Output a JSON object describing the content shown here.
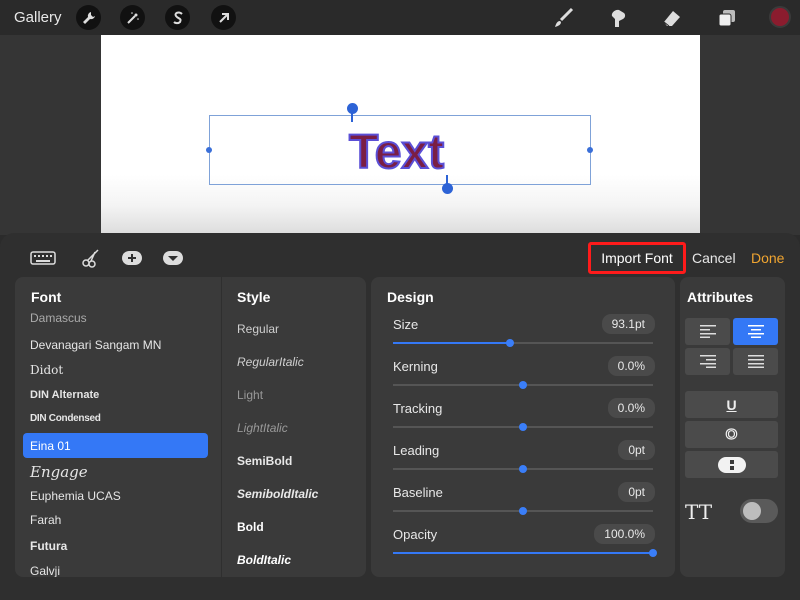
{
  "topbar": {
    "gallery_label": "Gallery",
    "tools": [
      "wrench-icon",
      "magic-wand-icon",
      "selection-s-icon",
      "transform-arrow-icon"
    ],
    "right_tools": [
      "brush-icon",
      "smudge-icon",
      "eraser-icon",
      "layers-icon"
    ],
    "color_swatch": "#8b1c2e"
  },
  "canvas": {
    "text": "Text",
    "text_fill": "#7a1e45",
    "text_stroke": "#5b4fd6"
  },
  "panel": {
    "tools": [
      "keyboard-icon",
      "scissors-icon",
      "add-icon",
      "dropdown-icon"
    ],
    "import_label": "Import Font",
    "cancel_label": "Cancel",
    "done_label": "Done",
    "accent": "#3478f6",
    "highlight": "#ff1b1b"
  },
  "font_column": {
    "header": "Font",
    "items": [
      "Damascus",
      "Devanagari Sangam MN",
      "Didot",
      "DIN Alternate",
      "DIN Condensed",
      "Eina 01",
      "Engage",
      "Euphemia UCAS",
      "Farah",
      "Futura",
      "Galvji"
    ],
    "selected": "Eina 01"
  },
  "style_column": {
    "header": "Style",
    "items": [
      "Regular",
      "RegularItalic",
      "Light",
      "LightItalic",
      "SemiBold",
      "SemiboldItalic",
      "Bold",
      "BoldItalic"
    ]
  },
  "design": {
    "header": "Design",
    "rows": [
      {
        "label": "Size",
        "value": "93.1pt",
        "level": 0.45
      },
      {
        "label": "Kerning",
        "value": "0.0%",
        "level": 0.5
      },
      {
        "label": "Tracking",
        "value": "0.0%",
        "level": 0.5
      },
      {
        "label": "Leading",
        "value": "0pt",
        "level": 0.5
      },
      {
        "label": "Baseline",
        "value": "0pt",
        "level": 0.5
      },
      {
        "label": "Opacity",
        "value": "100.0%",
        "level": 1.0
      }
    ]
  },
  "attributes": {
    "header": "Attributes",
    "alignment": [
      "align-left-icon",
      "align-center-icon",
      "align-right-icon",
      "align-justify-icon"
    ],
    "active_alignment": "align-center-icon",
    "underline_glyph": "U",
    "outline_glyph": "O",
    "tt_label": "TT",
    "tt_toggle_on": false
  }
}
